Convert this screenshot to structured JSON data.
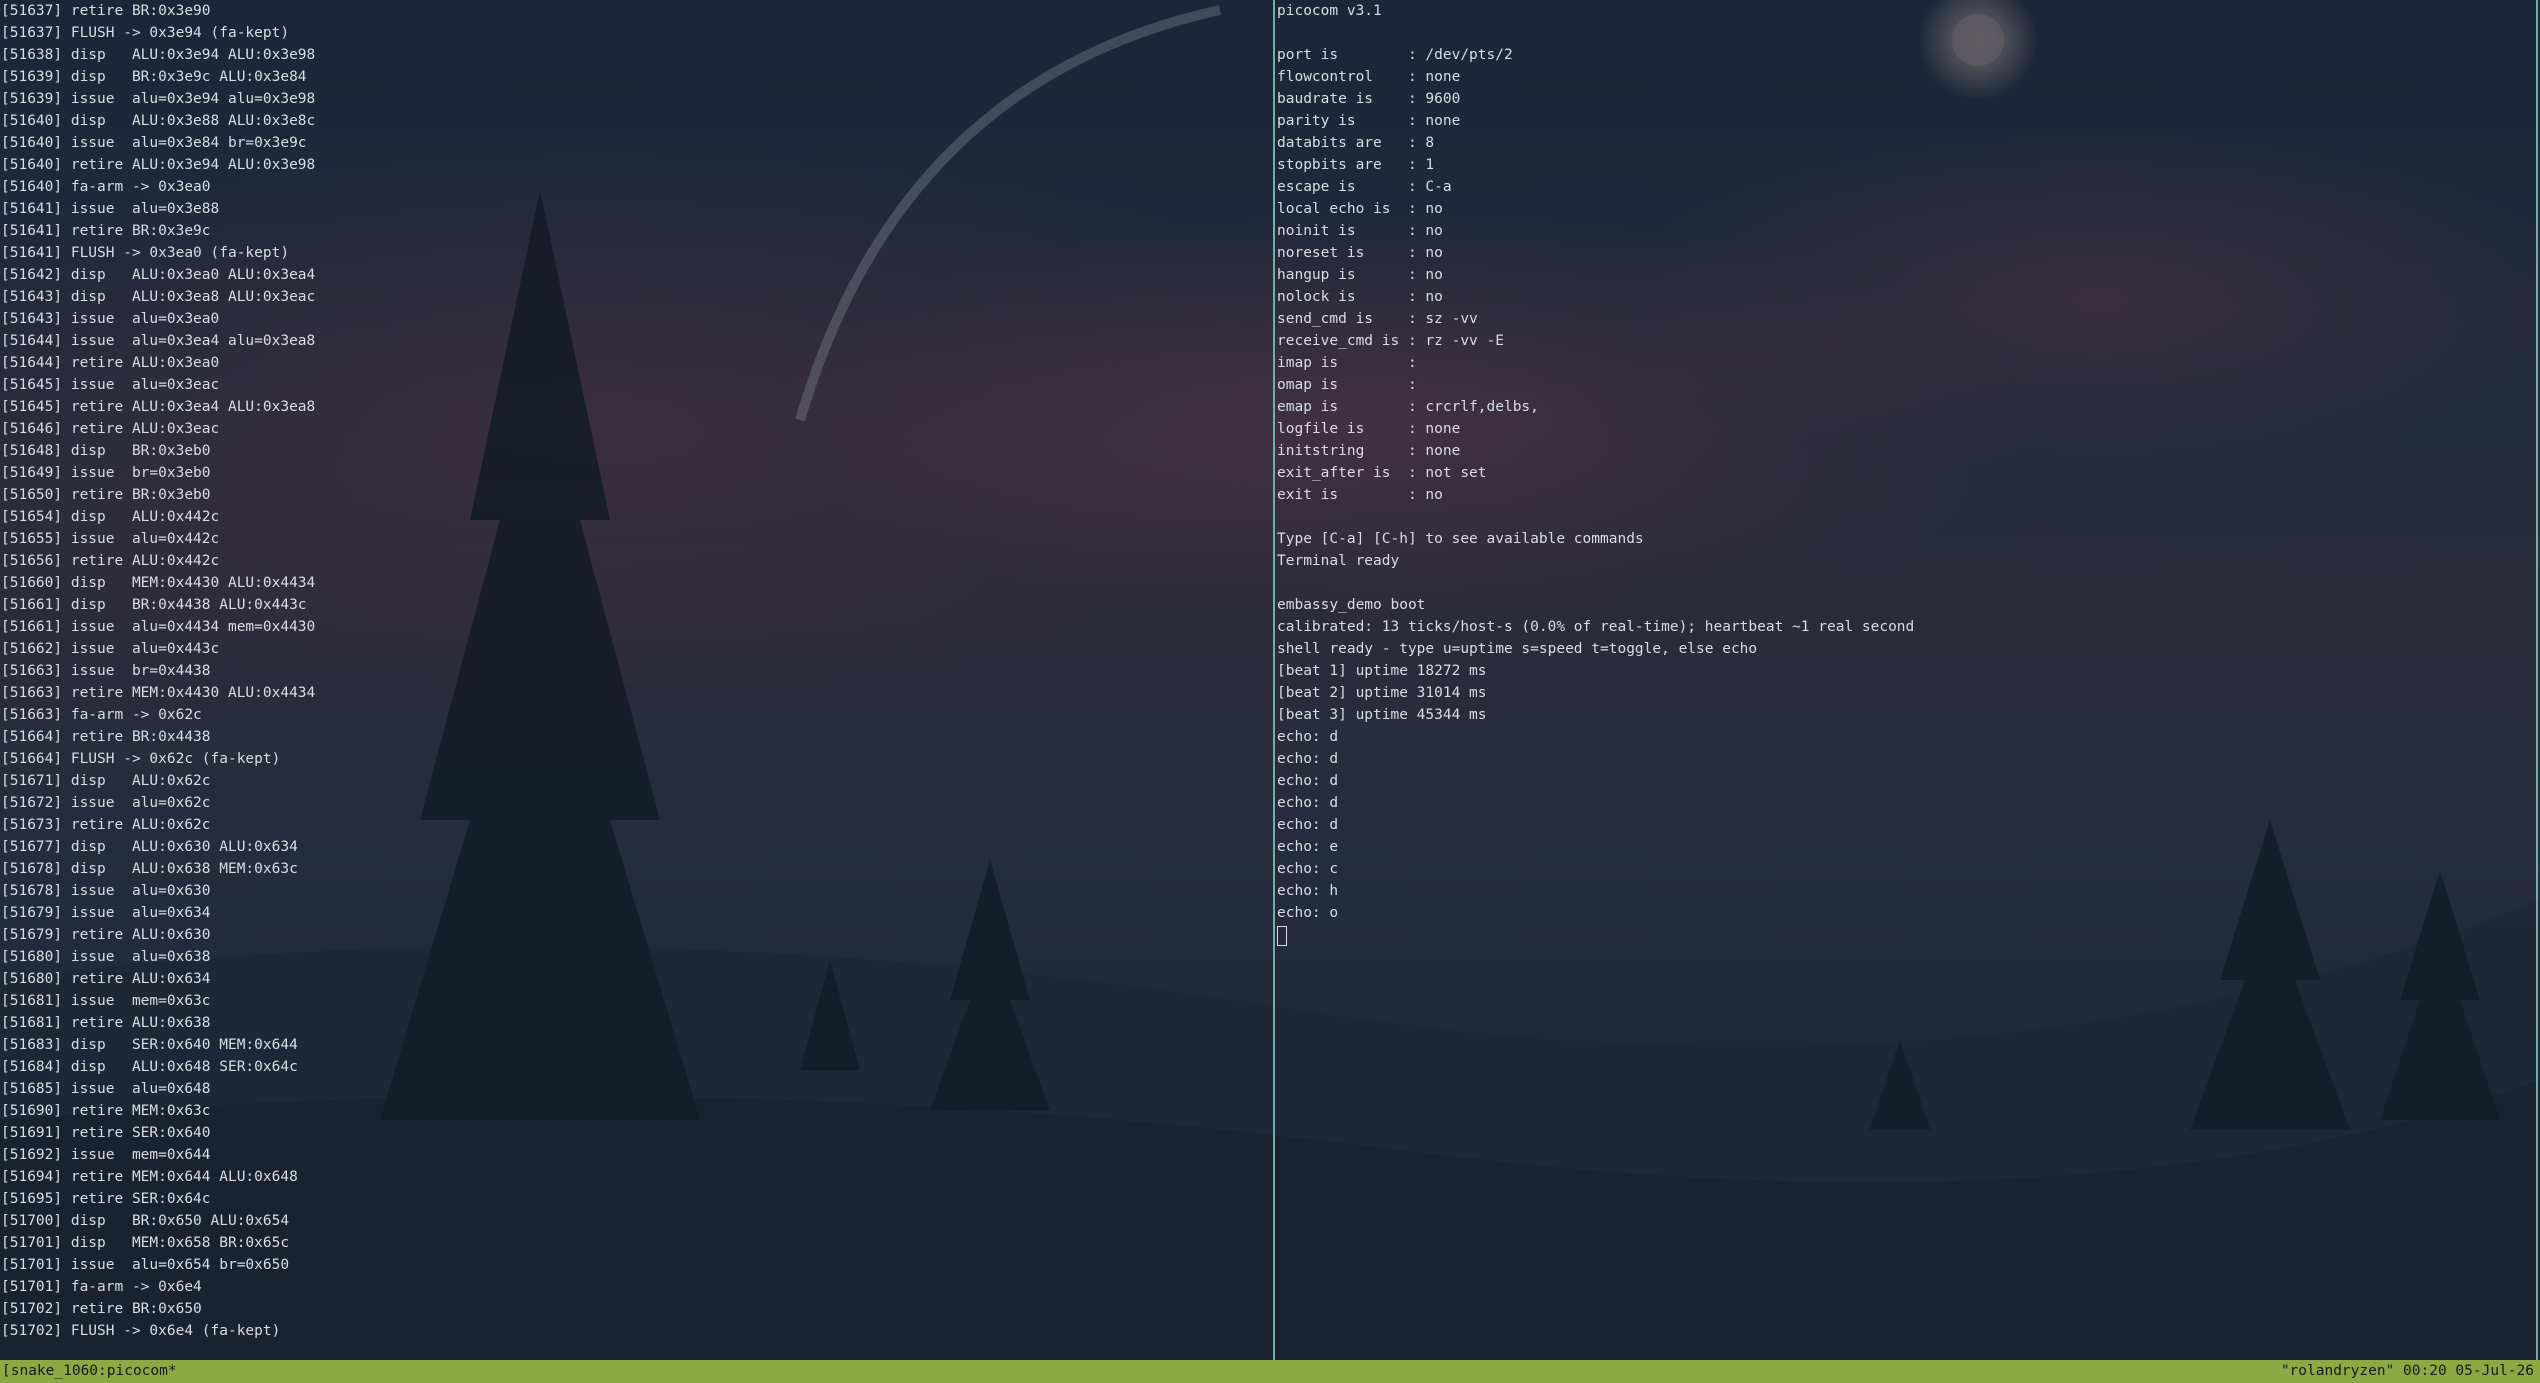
{
  "left_pane": {
    "lines": [
      "[51637] retire BR:0x3e90",
      "[51637] FLUSH -> 0x3e94 (fa-kept)",
      "[51638] disp   ALU:0x3e94 ALU:0x3e98",
      "[51639] disp   BR:0x3e9c ALU:0x3e84",
      "[51639] issue  alu=0x3e94 alu=0x3e98",
      "[51640] disp   ALU:0x3e88 ALU:0x3e8c",
      "[51640] issue  alu=0x3e84 br=0x3e9c",
      "[51640] retire ALU:0x3e94 ALU:0x3e98",
      "[51640] fa-arm -> 0x3ea0",
      "[51641] issue  alu=0x3e88",
      "[51641] retire BR:0x3e9c",
      "[51641] FLUSH -> 0x3ea0 (fa-kept)",
      "[51642] disp   ALU:0x3ea0 ALU:0x3ea4",
      "[51643] disp   ALU:0x3ea8 ALU:0x3eac",
      "[51643] issue  alu=0x3ea0",
      "[51644] issue  alu=0x3ea4 alu=0x3ea8",
      "[51644] retire ALU:0x3ea0",
      "[51645] issue  alu=0x3eac",
      "[51645] retire ALU:0x3ea4 ALU:0x3ea8",
      "[51646] retire ALU:0x3eac",
      "[51648] disp   BR:0x3eb0",
      "[51649] issue  br=0x3eb0",
      "[51650] retire BR:0x3eb0",
      "[51654] disp   ALU:0x442c",
      "[51655] issue  alu=0x442c",
      "[51656] retire ALU:0x442c",
      "[51660] disp   MEM:0x4430 ALU:0x4434",
      "[51661] disp   BR:0x4438 ALU:0x443c",
      "[51661] issue  alu=0x4434 mem=0x4430",
      "[51662] issue  alu=0x443c",
      "[51663] issue  br=0x4438",
      "[51663] retire MEM:0x4430 ALU:0x4434",
      "[51663] fa-arm -> 0x62c",
      "[51664] retire BR:0x4438",
      "[51664] FLUSH -> 0x62c (fa-kept)",
      "[51671] disp   ALU:0x62c",
      "[51672] issue  alu=0x62c",
      "[51673] retire ALU:0x62c",
      "[51677] disp   ALU:0x630 ALU:0x634",
      "[51678] disp   ALU:0x638 MEM:0x63c",
      "[51678] issue  alu=0x630",
      "[51679] issue  alu=0x634",
      "[51679] retire ALU:0x630",
      "[51680] issue  alu=0x638",
      "[51680] retire ALU:0x634",
      "[51681] issue  mem=0x63c",
      "[51681] retire ALU:0x638",
      "[51683] disp   SER:0x640 MEM:0x644",
      "[51684] disp   ALU:0x648 SER:0x64c",
      "[51685] issue  alu=0x648",
      "[51690] retire MEM:0x63c",
      "[51691] retire SER:0x640",
      "[51692] issue  mem=0x644",
      "[51694] retire MEM:0x644 ALU:0x648",
      "[51695] retire SER:0x64c",
      "[51700] disp   BR:0x650 ALU:0x654",
      "[51701] disp   MEM:0x658 BR:0x65c",
      "[51701] issue  alu=0x654 br=0x650",
      "[51701] fa-arm -> 0x6e4",
      "[51702] retire BR:0x650",
      "[51702] FLUSH -> 0x6e4 (fa-kept)"
    ]
  },
  "right_pane": {
    "lines": [
      "picocom v3.1",
      "",
      "port is        : /dev/pts/2",
      "flowcontrol    : none",
      "baudrate is    : 9600",
      "parity is      : none",
      "databits are   : 8",
      "stopbits are   : 1",
      "escape is      : C-a",
      "local echo is  : no",
      "noinit is      : no",
      "noreset is     : no",
      "hangup is      : no",
      "nolock is      : no",
      "send_cmd is    : sz -vv",
      "receive_cmd is : rz -vv -E",
      "imap is        :",
      "omap is        :",
      "emap is        : crcrlf,delbs,",
      "logfile is     : none",
      "initstring     : none",
      "exit_after is  : not set",
      "exit is        : no",
      "",
      "Type [C-a] [C-h] to see available commands",
      "Terminal ready",
      "",
      "embassy_demo boot",
      "calibrated: 13 ticks/host-s (0.0% of real-time); heartbeat ~1 real second",
      "shell ready - type u=uptime s=speed t=toggle, else echo",
      "[beat 1] uptime 18272 ms",
      "[beat 2] uptime 31014 ms",
      "[beat 3] uptime 45344 ms",
      "echo: d",
      "echo: d",
      "echo: d",
      "echo: d",
      "echo: d",
      "echo: e",
      "echo: c",
      "echo: h",
      "echo: o"
    ]
  },
  "status_bar": {
    "left": "[snake_1060:picocom*",
    "right": "\"rolandryzen\" 00:20 05-Jul-26"
  },
  "colors": {
    "status_bar_bg": "#8ea843",
    "pane_divider": "#6fb0a0",
    "terminal_text": "#d9dde3"
  }
}
